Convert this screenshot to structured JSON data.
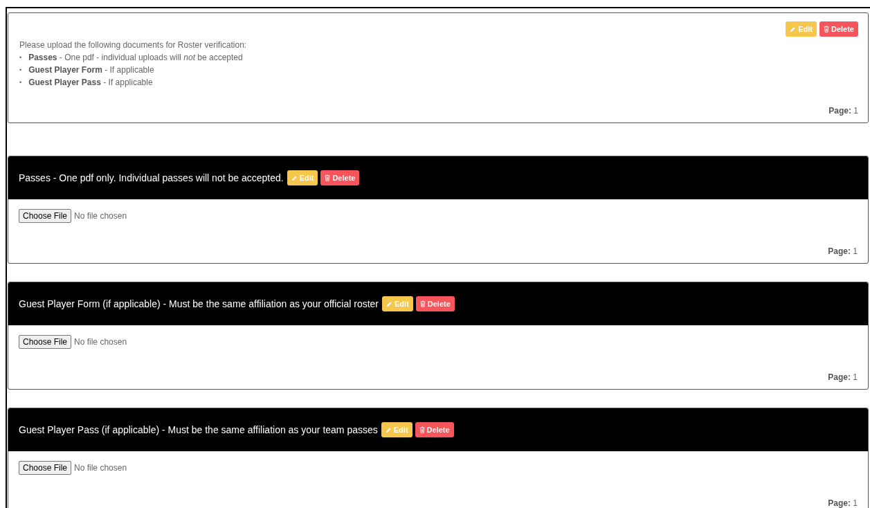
{
  "intro": {
    "edit_button": "Edit",
    "delete_button": "Delete",
    "heading": "Please upload the following documents for Roster verification:",
    "items": [
      {
        "bullet": "•",
        "text": "**Passes** - One pdf - individual uploads will *not* be accepted"
      },
      {
        "bullet": "•",
        "text": "**Guest Player Form** - If applicable"
      },
      {
        "bullet": "•",
        "text": "**Guest Player Pass** - If applicable"
      }
    ],
    "page": "**Page:** 1"
  },
  "sections": [
    {
      "title": "Passes - One pdf only. Individual passes will not be accepted.",
      "edit_button": "Edit",
      "delete_button": "Delete",
      "file_button": "Choose File",
      "file_status": "No file chosen",
      "page": "**Page:** 1"
    },
    {
      "title": "Guest Player Form (if applicable) - Must be the same affiliation as your official roster",
      "edit_button": "Edit",
      "delete_button": "Delete",
      "file_button": "Choose File",
      "file_status": "No file chosen",
      "page": "**Page:** 1"
    },
    {
      "title": "Guest Player Pass (if applicable) - Must be the same affiliation as your team passes",
      "edit_button": "Edit",
      "delete_button": "Delete",
      "file_button": "Choose File",
      "file_status": "No file chosen",
      "page": "**Page:** 1"
    }
  ]
}
